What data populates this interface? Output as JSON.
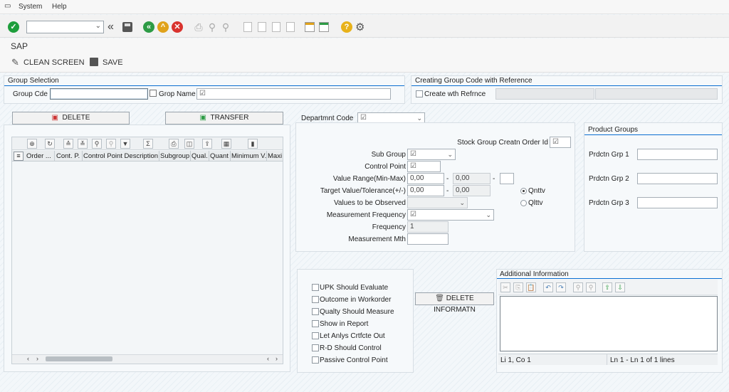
{
  "menu": {
    "system": "System",
    "help": "Help"
  },
  "app": {
    "title": "SAP"
  },
  "app_toolbar": {
    "clean_screen": "CLEAN SCREEN",
    "save": "SAVE"
  },
  "group_selection": {
    "title": "Group Selection",
    "group_code_label": "Group Cde",
    "group_code_value": "",
    "group_name_label": "Grop Name"
  },
  "reference": {
    "title": "Creating Group Code with Reference",
    "checkbox_label": "Create wth Refrnce"
  },
  "actions": {
    "delete": "DELETE",
    "transfer": "TRANSFER"
  },
  "grid": {
    "columns": [
      "Order ...",
      "Cont. P.",
      "Control Point Description",
      "Subgroup",
      "Qual.",
      "Quant",
      "Minimum V.",
      "Maxi"
    ]
  },
  "department": {
    "label": "Departmnt Code"
  },
  "details": {
    "stock_group_label": "Stock Group Creatn Order Id",
    "sub_group_label": "Sub Group",
    "control_point_label": "Control Point",
    "value_range_label": "Value Range(Min-Max)",
    "value_range_min": "0,00",
    "value_range_max": "0,00",
    "target_label": "Target Value/Tolerance(+/-)",
    "target_value": "0,00",
    "tolerance_value": "0,00",
    "values_observed_label": "Values to be Observed",
    "measurement_freq_label": "Measurement Frequency",
    "frequency_label": "Frequency",
    "frequency_value": "1",
    "measurement_mth_label": "Measurement Mth",
    "dash": "-",
    "radio_quantitative": "Qnttv",
    "radio_qualitative": "Qlttv"
  },
  "product_groups": {
    "title": "Product Groups",
    "grp1": "Prdctn Grp 1",
    "grp2": "Prdctn Grp 2",
    "grp3": "Prdctn Grp 3"
  },
  "flags": {
    "upk": "UPK Should Evaluate",
    "outcome": "Outcome in Workorder",
    "quality": "Qualty Should Measure",
    "report": "Show in Report",
    "certificate": "Let Anlys Crtfcte Out",
    "rd": "R-D Should Control",
    "passive": "Passive Control Point"
  },
  "delete_info": {
    "label": "DELETE INFORMATN"
  },
  "additional_info": {
    "title": "Additional Information",
    "cursor_pos": "Li 1, Co 1",
    "lines": "Ln 1 - Ln 1 of 1 lines"
  },
  "colors": {
    "accent": "#0a6ed1",
    "ok": "#1e9e3c",
    "back": "#2d9b45",
    "exit": "#e0a21b",
    "cancel": "#d9332e"
  }
}
